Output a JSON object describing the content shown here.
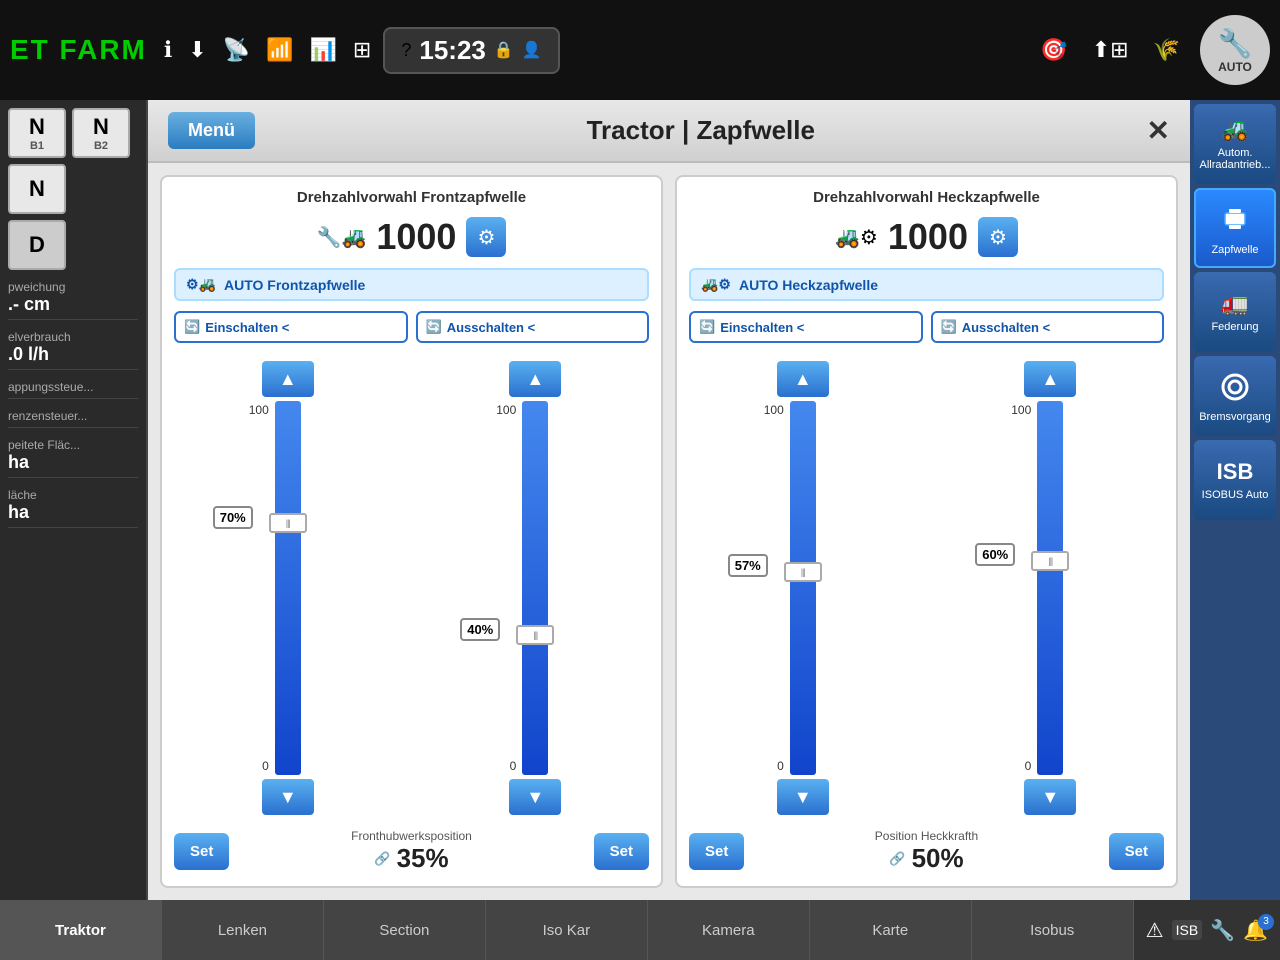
{
  "topBar": {
    "logo": "ET FARM",
    "time": "15:23",
    "autoBadge": "AUTO"
  },
  "leftSidebar": {
    "badge1": {
      "label": "N",
      "sub": "B1"
    },
    "badge2": {
      "label": "N",
      "sub": "B2"
    },
    "badge3": {
      "label": "N"
    },
    "badge4": {
      "label": "D"
    },
    "row1Label": "pweichung",
    "row1Val": ".- cm",
    "row2Label": "elverbrauch",
    "row2Val": ".0 l/h",
    "row3Label": "appungssteue...",
    "row4Label": "renzensteuer...",
    "row5Label": "peitete Fläc...",
    "row5Val": "ha",
    "row6Label": "läche",
    "row6Val": "ha"
  },
  "modal": {
    "menuLabel": "Menü",
    "title": "Tractor | Zapfwelle",
    "closeLabel": "✕",
    "frontPanel": {
      "rpmTitle": "Drehzahlvorwahl Frontzapfwelle",
      "rpmValue": "1000",
      "autoLabel": "AUTO Frontzapfwelle",
      "einschalten": "Einschalten <",
      "ausschalten": "Ausschalten <",
      "slider1Pct": "70%",
      "slider1Max": "100",
      "slider1Min": "0",
      "slider2Pct": "40%",
      "slider2Max": "100",
      "slider2Min": "0",
      "hitchTitle": "Fronthubwerksposition",
      "hitchPct": "35%",
      "setLabel": "Set"
    },
    "rearPanel": {
      "rpmTitle": "Drehzahlvorwahl Heckzapfwelle",
      "rpmValue": "1000",
      "autoLabel": "AUTO Heckzapfwelle",
      "einschalten": "Einschalten <",
      "ausschalten": "Ausschalten <",
      "slider1Pct": "57%",
      "slider1Max": "100",
      "slider1Min": "0",
      "slider2Pct": "60%",
      "slider2Max": "100",
      "slider2Min": "0",
      "hitchTitle": "Position Heckkrafth",
      "hitchPct": "50%",
      "setLabel": "Set"
    }
  },
  "rightSidebar": {
    "btn1Label": "Autom. Allradantrieb...",
    "btn2Label": "Zapfwelle",
    "btn3Label": "Federung",
    "btn4Label": "Bremsvorgang",
    "btn5Label": "ISOBUS Auto",
    "isbLabel": "ISB"
  },
  "bottomBar": {
    "tabs": [
      {
        "label": "Traktor",
        "active": false
      },
      {
        "label": "Lenken",
        "active": false
      },
      {
        "label": "Section",
        "active": false
      },
      {
        "label": "Iso Kar",
        "active": false
      },
      {
        "label": "Kamera",
        "active": false
      },
      {
        "label": "Karte",
        "active": false
      },
      {
        "label": "Isobus",
        "active": false
      }
    ],
    "notifCount": "3"
  }
}
